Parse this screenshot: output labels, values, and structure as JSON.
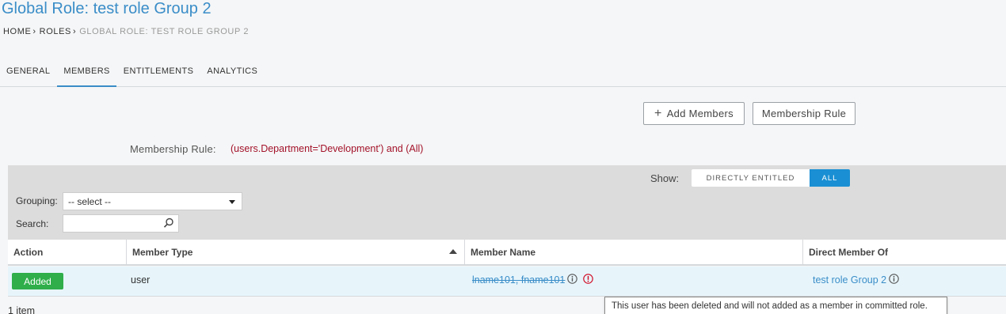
{
  "page": {
    "title": "Global Role: test role Group 2"
  },
  "breadcrumb": [
    {
      "label": "HOME"
    },
    {
      "label": "ROLES"
    },
    {
      "label": "GLOBAL ROLE: TEST ROLE GROUP 2"
    }
  ],
  "tabs": [
    {
      "label": "GENERAL",
      "active": false
    },
    {
      "label": "MEMBERS",
      "active": true
    },
    {
      "label": "ENTITLEMENTS",
      "active": false
    },
    {
      "label": "ANALYTICS",
      "active": false
    }
  ],
  "toolbar": {
    "add_members_label": "Add Members",
    "membership_rule_label": "Membership Rule"
  },
  "membership_rule": {
    "label": "Membership Rule:",
    "value": "(users.Department='Development') and (All)"
  },
  "filters": {
    "show_label": "Show:",
    "show_options": [
      {
        "label": "DIRECTLY ENTITLED",
        "selected": false
      },
      {
        "label": "ALL",
        "selected": true
      }
    ],
    "grouping_label": "Grouping:",
    "grouping_value": "-- select --",
    "search_label": "Search:",
    "search_value": ""
  },
  "table": {
    "columns": [
      "Action",
      "Member Type",
      "Member Name",
      "Direct Member Of"
    ],
    "sort_column": "Member Type",
    "sort_direction": "asc",
    "rows": [
      {
        "action": "Added",
        "member_type": "user",
        "member_name": "lname101, fname101",
        "member_deleted": true,
        "direct_member_of": "test role Group 2"
      }
    ],
    "item_count": "1 item"
  },
  "tooltip": {
    "text": "This user has been deleted and will not added as a member in committed role."
  },
  "colors": {
    "accent": "#3a8dc8",
    "added_badge": "#2fae4a",
    "rule_text": "#a3122a",
    "toggle_active": "#1a8fd3",
    "alert": "#d0021b"
  }
}
